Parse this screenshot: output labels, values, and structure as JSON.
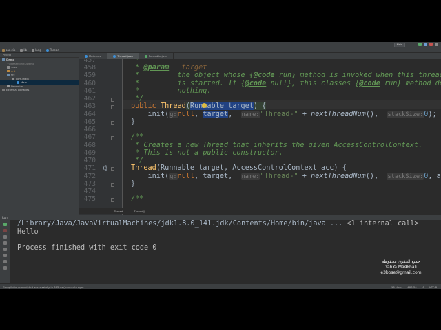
{
  "navbar": {
    "crumbs": [
      "aaa.zip",
      "lib",
      "lang",
      "Thread"
    ]
  },
  "run_config": "Main",
  "project": {
    "header": "Project",
    "tree": [
      {
        "label": "Demo",
        "depth": 0
      },
      {
        "label": "~/IdeaProjects/Demo",
        "depth": 1
      },
      {
        "label": ".idea",
        "depth": 1
      },
      {
        "label": "out",
        "depth": 1
      },
      {
        "label": "src",
        "depth": 1
      },
      {
        "label": "com.main",
        "depth": 2
      },
      {
        "label": "Main",
        "depth": 3
      },
      {
        "label": "Demo.iml",
        "depth": 1
      },
      {
        "label": "External Libraries",
        "depth": 0
      }
    ]
  },
  "tabs": [
    {
      "label": "Main.java",
      "active": false
    },
    {
      "label": "Thread.java",
      "active": true
    },
    {
      "label": "Runnable.java",
      "active": false
    }
  ],
  "editor": {
    "lines": [
      {
        "n": "457"
      },
      {
        "n": "458"
      },
      {
        "n": "459"
      },
      {
        "n": "460"
      },
      {
        "n": "461"
      },
      {
        "n": "462"
      },
      {
        "n": "463"
      },
      {
        "n": "464"
      },
      {
        "n": "465"
      },
      {
        "n": "466"
      },
      {
        "n": "467"
      },
      {
        "n": "468"
      },
      {
        "n": "469"
      },
      {
        "n": "470"
      },
      {
        "n": "471"
      },
      {
        "n": "472"
      },
      {
        "n": "473"
      },
      {
        "n": "474"
      },
      {
        "n": "475"
      }
    ],
    "gutter_marker": "@",
    "code": {
      "l457": " *",
      "l458_star": " * ",
      "l458_tag": "@param",
      "l458_name": "target",
      "l459_a": " *         the object whose {",
      "l459_code": "@code",
      "l459_b": " run} method is invoked when this thread",
      "l460_a": " *         is started. If {",
      "l460_code1": "@code",
      "l460_b": " null}, this classes {",
      "l460_code2": "@code",
      "l460_c": " run} method does",
      "l461": " *         nothing.",
      "l462": " */",
      "l463_kw": "public ",
      "l463_fn": "Thread",
      "l463_p1": "(",
      "l463_type": "Runnable target",
      "l463_p2": ") {",
      "l464_indent": "    init(",
      "l464_h1": "g:",
      "l464_null": "null",
      "l464_c1": ", ",
      "l464_target": "target",
      "l464_c2": ",  ",
      "l464_h2": "name:",
      "l464_str": "\"Thread-\"",
      "l464_plus": " + ",
      "l464_fn": "nextThreadNum",
      "l464_c3": "(),  ",
      "l464_h3": "stackSize:",
      "l464_zero": "0",
      "l464_end": ");",
      "l465": "}",
      "l466": "",
      "l467": "/**",
      "l468": " * Creates a new Thread that inherits the given AccessControlContext.",
      "l469": " * This is not a public constructor.",
      "l470": " */",
      "l471_fn": "Thread",
      "l471_rest": "(Runnable target, AccessControlContext acc) {",
      "l472_indent": "    init(",
      "l472_h1": "g:",
      "l472_null": "null",
      "l472_c1": ", target,  ",
      "l472_h2": "name:",
      "l472_str": "\"Thread-\"",
      "l472_plus": " + ",
      "l472_fn": "nextThreadNum",
      "l472_c3": "(),  ",
      "l472_h3": "stackSize:",
      "l472_zero": "0",
      "l472_end": ", acc,  ",
      "l472_h4": "inh",
      "l473": "}",
      "l474": "",
      "l475": "/**"
    }
  },
  "editor_crumbs": [
    "Thread",
    "Thread()"
  ],
  "run": {
    "header": "Run",
    "lines": [
      "/Library/Java/JavaVirtualMachines/jdk1.8.0_141.jdk/Contents/Home/bin/java ...",
      "<1 internal call>",
      "Hello",
      "",
      "Process finished with exit code 0"
    ]
  },
  "status": {
    "left": "Compilation completed successfully in 865ms (moments ago)",
    "right": [
      "16 chars",
      "463:34",
      "LF",
      "UTF-8"
    ]
  },
  "watermark": {
    "arabic": "جميع الحقوق محفوظة",
    "name": "YahYa Madkhali",
    "email": "e3bose@gmail.com"
  }
}
